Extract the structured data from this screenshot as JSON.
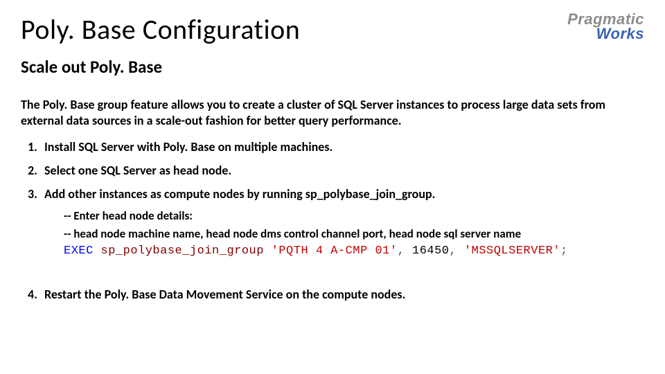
{
  "title": "Poly. Base Configuration",
  "logo": {
    "line1": "Pragmatic",
    "line2": "Works"
  },
  "subtitle": "Scale out Poly. Base",
  "intro": "The Poly. Base group feature allows you to create a cluster of SQL Server instances to process large data sets from external data sources in a scale-out fashion for better query performance.",
  "steps": {
    "s1": "Install SQL Server with Poly. Base on multiple machines.",
    "s2": "Select one SQL Server as head node.",
    "s3": "Add other instances as compute nodes by running sp_polybase_join_group.",
    "s4": "Restart the Poly. Base Data Movement Service on the compute nodes."
  },
  "code": {
    "comment1": "-- Enter head node details:",
    "comment2": "-- head node machine name, head node dms control channel port, head node sql server name",
    "kw": "EXEC",
    "proc": "sp_polybase_join_group",
    "arg1": "'PQTH 4 A-CMP 01'",
    "arg2": "16450",
    "arg3": "'MSSQLSERVER'"
  }
}
